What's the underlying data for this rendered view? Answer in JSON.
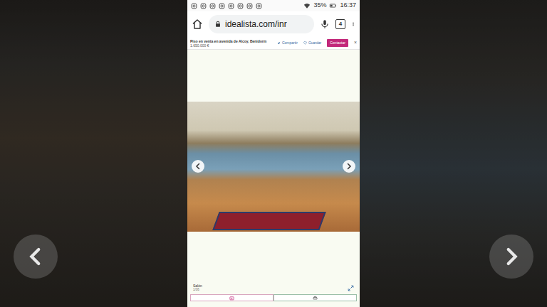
{
  "status_bar": {
    "battery": "35%",
    "time": "16:37"
  },
  "browser": {
    "url": "idealista.com/inr",
    "tab_count": "4"
  },
  "listing": {
    "title": "Piso en venta en avenida de Alcoy, Benidorm",
    "price": "1.650.000 €",
    "actions": [
      "Compartir",
      "Guardar"
    ],
    "contact": "Contactar",
    "close": "×"
  },
  "gallery": {
    "caption": "Salón",
    "counter": "1/36"
  }
}
